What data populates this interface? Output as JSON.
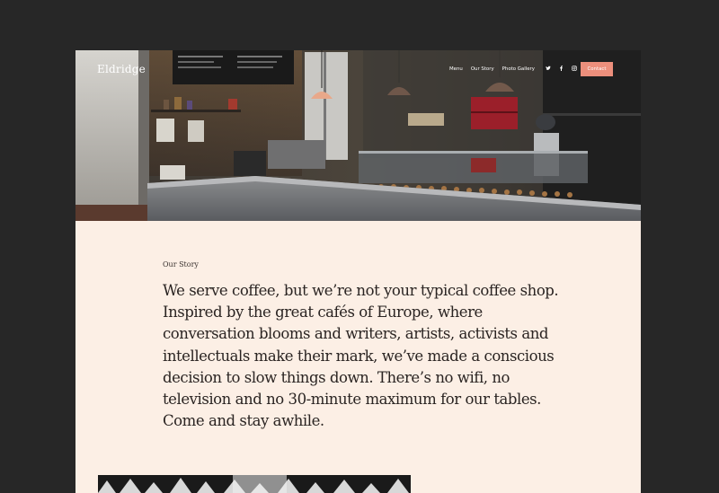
{
  "site": {
    "logo": "Eldridge"
  },
  "nav": {
    "items": [
      {
        "label": "Menu"
      },
      {
        "label": "Our Story"
      },
      {
        "label": "Photo Gallery"
      }
    ],
    "social": [
      {
        "icon": "twitter-icon",
        "glyph": "🐦"
      },
      {
        "icon": "facebook-icon",
        "glyph": "f"
      },
      {
        "icon": "instagram-icon",
        "glyph": "◎"
      }
    ],
    "contact_label": "Contact"
  },
  "story": {
    "label": "Our Story",
    "text": "We serve coffee, but we’re not your typical coffee shop. Inspired by the great cafés of Europe, where conversation blooms and writers, artists, activists and intellectuals make their mark, we’ve made a conscious decision to slow things down. There’s no wifi, no television and no 30-minute maximum for our tables. Come and stay awhile."
  },
  "colors": {
    "background": "#272727",
    "page": "#fcefe5",
    "accent": "#ec8f7c",
    "text": "#2a2422"
  }
}
